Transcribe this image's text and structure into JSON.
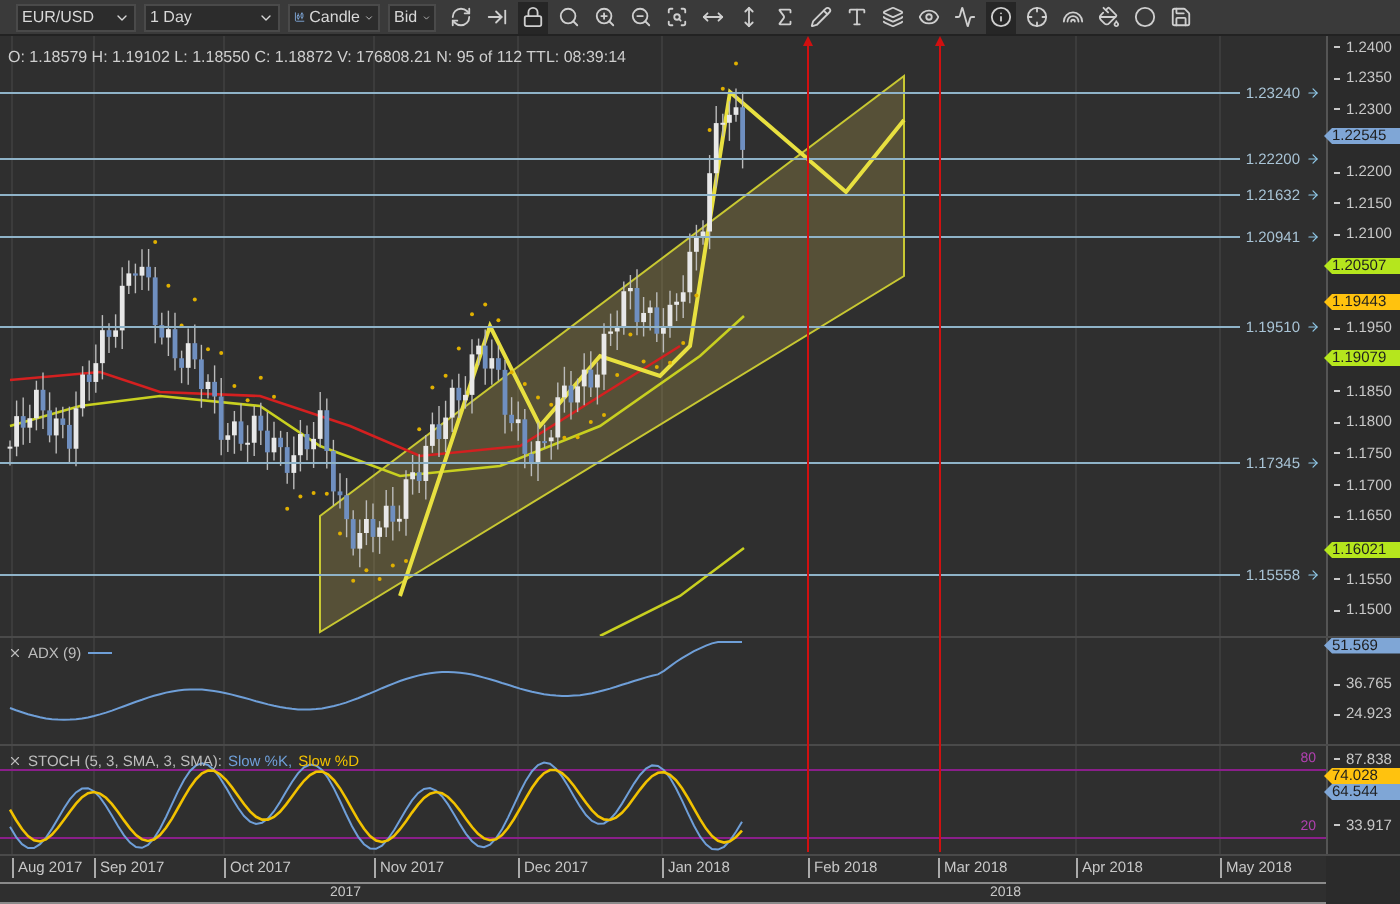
{
  "toolbar": {
    "selects": [
      {
        "kind": "symbol",
        "value": "EUR/USD"
      },
      {
        "kind": "period",
        "value": "1 Day"
      },
      {
        "kind": "chart-type",
        "value": "Candle"
      },
      {
        "kind": "side",
        "value": "Bid"
      }
    ],
    "tools": [
      {
        "kind": "refresh",
        "selected": false
      },
      {
        "kind": "scroll-end",
        "selected": false
      },
      {
        "kind": "lock",
        "selected": true
      },
      {
        "kind": "zoom",
        "selected": false
      },
      {
        "kind": "zoom-in",
        "selected": false
      },
      {
        "kind": "zoom-out",
        "selected": false
      },
      {
        "kind": "zoom-fit",
        "selected": false
      },
      {
        "kind": "fit-horizontal",
        "selected": false
      },
      {
        "kind": "fit-vertical",
        "selected": false
      },
      {
        "kind": "function",
        "selected": false
      },
      {
        "kind": "pencil",
        "selected": false
      },
      {
        "kind": "text",
        "selected": false
      },
      {
        "kind": "layers",
        "selected": false
      },
      {
        "kind": "eye",
        "selected": false
      },
      {
        "kind": "signal",
        "selected": false
      },
      {
        "kind": "info",
        "selected": true
      },
      {
        "kind": "crosshair",
        "selected": false
      },
      {
        "kind": "colors",
        "selected": false
      },
      {
        "kind": "paint",
        "selected": false
      },
      {
        "kind": "circle",
        "selected": false
      },
      {
        "kind": "save",
        "selected": false
      }
    ]
  },
  "price_panel": {
    "info": "O: 1.18579 H: 1.19102 L: 1.18550 C: 1.18872 V: 176808.21 N: 95 of 112 TTL: 08:39:14",
    "axis_ticks": [
      "1.2400",
      "1.2350",
      "1.2300",
      "1.2200",
      "1.2150",
      "1.2100",
      "1.1950",
      "1.1850",
      "1.1800",
      "1.1750",
      "1.1700",
      "1.1650",
      "1.1550",
      "1.1500"
    ],
    "levels": [
      {
        "label": "1.23240"
      },
      {
        "label": "1.22200"
      },
      {
        "label": "1.21632"
      },
      {
        "label": "1.20941"
      },
      {
        "label": "1.19510"
      },
      {
        "label": "1.17345"
      },
      {
        "label": "1.15558"
      }
    ],
    "tags": [
      {
        "label": "1.22545",
        "color": "#7fa6d6"
      },
      {
        "label": "1.20507",
        "color": "#b5e61d"
      },
      {
        "label": "1.19443",
        "color": "#ffc20e"
      },
      {
        "label": "1.19079",
        "color": "#b5e61d"
      },
      {
        "label": "1.16021",
        "color": "#b5e61d"
      }
    ]
  },
  "adx_panel": {
    "title": "ADX (9)",
    "axis_ticks": [
      "36.765",
      "24.923"
    ],
    "tags": [
      {
        "label": "51.569",
        "color": "#7fa6d6"
      }
    ]
  },
  "stoch_panel": {
    "title": "STOCH (5, 3, SMA, 3, SMA):",
    "series": [
      {
        "name": "Slow %K,",
        "color": "#6f9fd8"
      },
      {
        "name": "Slow %D",
        "color": "#f2c200"
      }
    ],
    "bands": [
      "80",
      "20"
    ],
    "axis_ticks": [
      "87.838",
      "33.917"
    ],
    "tags": [
      {
        "label": "74.028",
        "color": "#ffc20e"
      },
      {
        "label": "64.544",
        "color": "#7fa6d6"
      }
    ]
  },
  "time_axis": {
    "months": [
      "Aug 2017",
      "Sep 2017",
      "Oct 2017",
      "Nov 2017",
      "Dec 2017",
      "Jan 2018",
      "Feb 2018",
      "Mar 2018",
      "Apr 2018",
      "May 2018"
    ],
    "years": [
      "2017",
      "2018"
    ]
  }
}
